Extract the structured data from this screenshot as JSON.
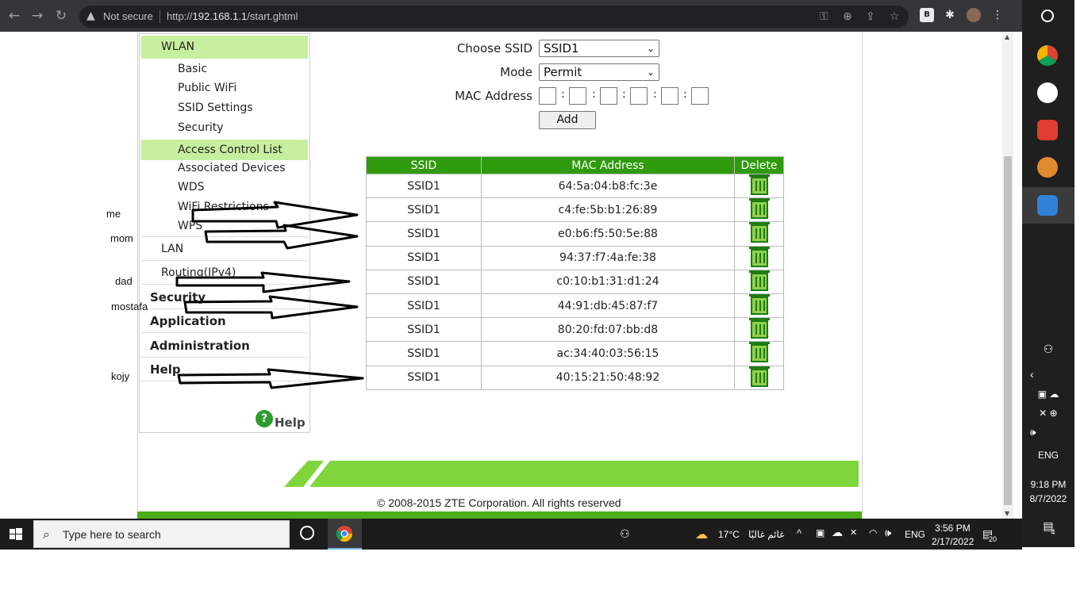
{
  "browser": {
    "not_secure": "Not secure",
    "url_prefix": "http://",
    "url_host": "192.168.1.1",
    "url_path": "/start.ghtml"
  },
  "menu": {
    "wlan": "WLAN",
    "basic": "Basic",
    "public_wifi": "Public WiFi",
    "ssid_settings": "SSID Settings",
    "security_sub": "Security",
    "access_control_list": "Access Control List",
    "associated_devices": "Associated Devices",
    "wds": "WDS",
    "wifi_restrictions": "WiFi Restrictions",
    "wps": "WPS",
    "lan": "LAN",
    "routing": "Routing(IPv4)",
    "security": "Security",
    "application": "Application",
    "administration": "Administration",
    "help": "Help",
    "help_link": "Help",
    "help_icon": "?"
  },
  "form": {
    "choose_ssid_label": "Choose SSID",
    "choose_ssid_value": "SSID1",
    "mode_label": "Mode",
    "mode_value": "Permit",
    "mac_label": "MAC Address",
    "colon": ":",
    "add_label": "Add"
  },
  "table": {
    "headers": [
      "SSID",
      "MAC Address",
      "Delete"
    ],
    "rows": [
      {
        "ssid": "SSID1",
        "mac": "64:5a:04:b8:fc:3e"
      },
      {
        "ssid": "SSID1",
        "mac": "c4:fe:5b:b1:26:89"
      },
      {
        "ssid": "SSID1",
        "mac": "e0:b6:f5:50:5e:88"
      },
      {
        "ssid": "SSID1",
        "mac": "94:37:f7:4a:fe:38"
      },
      {
        "ssid": "SSID1",
        "mac": "c0:10:b1:31:d1:24"
      },
      {
        "ssid": "SSID1",
        "mac": "44:91:db:45:87:f7"
      },
      {
        "ssid": "SSID1",
        "mac": "80:20:fd:07:bb:d8"
      },
      {
        "ssid": "SSID1",
        "mac": "ac:34:40:03:56:15"
      },
      {
        "ssid": "SSID1",
        "mac": "40:15:21:50:48:92"
      }
    ]
  },
  "footer": {
    "copyright": "© 2008-2015 ZTE Corporation. All rights reserved"
  },
  "annotations": {
    "me": "me",
    "mom": "mom",
    "dad": "dad",
    "mostafa": "mostafa",
    "kojy": "kojy"
  },
  "taskbar": {
    "search_placeholder": "Type here to search",
    "weather": "17°C",
    "weather_text": "غائم غالبًا",
    "lang": "ENG",
    "time": "3:56 PM",
    "date": "2/17/2022",
    "notif_count": "20"
  },
  "side_panel": {
    "lang": "ENG",
    "time": "9:18 PM",
    "date": "8/7/2022",
    "notif_count": "4"
  },
  "colors": {
    "brand_green": "#2f9a0c",
    "menu_highlight": "#c6ef9f",
    "band_green": "#7ed63c"
  }
}
